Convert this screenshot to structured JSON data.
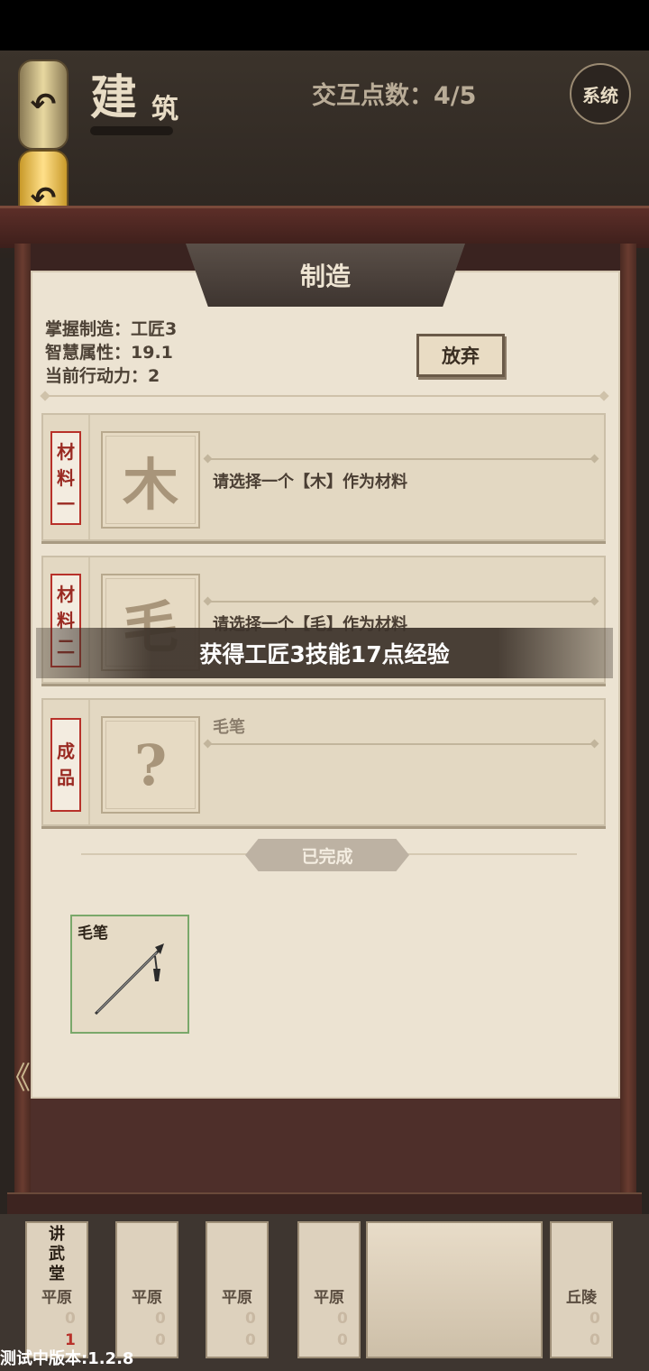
{
  "header": {
    "title_main": "建",
    "title_sub": "筑",
    "interact_points": "交互点数：4/5",
    "system_button": "系统",
    "back_label": "↶",
    "back_label_2": "↶"
  },
  "panel": {
    "tab_title": "制造",
    "info": {
      "skill": "掌握制造：工匠3",
      "wisdom": "智慧属性：19.1",
      "action_points": "当前行动力：2"
    },
    "give_up_button": "放弃",
    "materials": [
      {
        "tag": [
          "材",
          "料",
          "一"
        ],
        "slot_char": "木",
        "text": "请选择一个【木】作为材料"
      },
      {
        "tag": [
          "材",
          "料",
          "二"
        ],
        "slot_char": "毛",
        "text": "请选择一个【毛】作为材料"
      }
    ],
    "product": {
      "tag": [
        "成",
        "品"
      ],
      "slot_char": "?",
      "name": "毛笔"
    },
    "completed_label": "已完成",
    "completed_items": [
      {
        "name": "毛笔",
        "icon": "brush-icon"
      }
    ]
  },
  "toast": "获得工匠3技能17点经验",
  "side_arrow": "《",
  "bottom_slots": [
    {
      "title": [
        "讲",
        "武",
        "堂"
      ],
      "terrain": "平原",
      "count1": "0",
      "count2": "1"
    },
    {
      "title": [],
      "terrain": "平原",
      "count1": "0",
      "count2": "0"
    },
    {
      "title": [],
      "terrain": "平原",
      "count1": "0",
      "count2": "0"
    },
    {
      "title": [],
      "terrain": "平原",
      "count1": "0",
      "count2": "0"
    },
    {
      "title": [],
      "terrain": "丘陵",
      "count1": "0",
      "count2": "0"
    }
  ],
  "version": "测试中版本:1.2.8"
}
